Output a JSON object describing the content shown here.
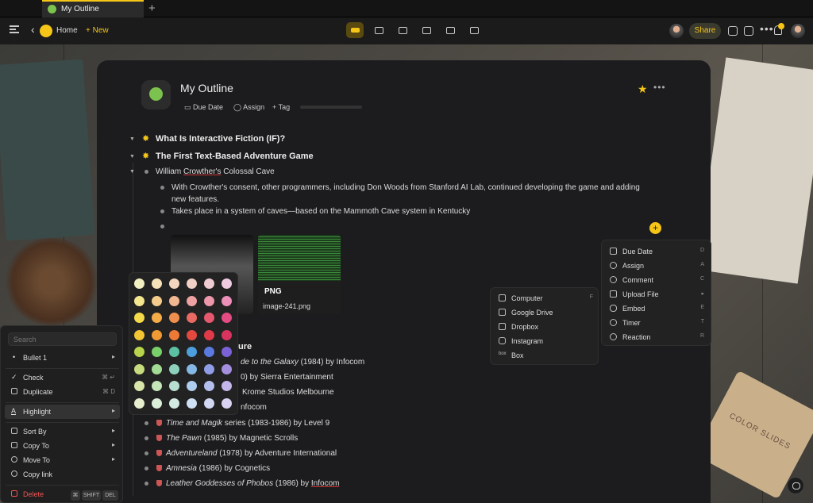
{
  "tab": {
    "title": "My Outline"
  },
  "toolbar": {
    "home": "Home",
    "new": "New",
    "share": "Share"
  },
  "doc": {
    "title": "My Outline",
    "meta": {
      "due_date": "Due Date",
      "assign": "Assign",
      "tag": "Tag"
    }
  },
  "outline": {
    "h1": "What Is Interactive Fiction (IF)?",
    "h2": "The First Text-Based Adventure Game",
    "crowther_a": "William ",
    "crowther_b": "Crowther's",
    "crowther_c": " Colossal Cave",
    "consent_1": "With Crowther's consent, other programmers, including Don Woods from Stanford AI Lab, continued developing the game and adding",
    "consent_2": "new features.",
    "caves": "Takes place in a system of caves—based on the Mammoth Cave system in Kentucky",
    "image": {
      "type": "PNG",
      "name": "image-241.png"
    },
    "partial_heading": "ure",
    "p1a": "de to the Galaxy",
    "p1b": " (1984) by Infocom",
    "p2": "0) by Sierra Entertainment",
    "p3": "Krome Studios Melbourne",
    "p4": "nfocom",
    "g1a": "Time and Magik",
    "g1b": " series (1983-1986) by Level 9",
    "g2a": "The Pawn",
    "g2b": " (1985) by Magnetic Scrolls",
    "g3a": "Adventureland",
    "g3b": " (1978) by Adventure International",
    "g4a": "Amnesia",
    "g4b": " (1986) by Cognetics",
    "g5a": "Leather Goddesses of Phobos",
    "g5b": " (1986) by ",
    "g5c": "Infocom"
  },
  "palette": [
    [
      "#f2efc0",
      "#f6e2b8",
      "#f3d6bd",
      "#f0cfc4",
      "#efcbd3",
      "#eecbe1"
    ],
    [
      "#f3e68e",
      "#f5cb8c",
      "#f2b891",
      "#eda1a1",
      "#ed97ab",
      "#ec8fb9"
    ],
    [
      "#f4d94a",
      "#f4ac49",
      "#ef8f4f",
      "#e96a63",
      "#e5586e",
      "#e24c83"
    ],
    [
      "#f1c533",
      "#f09a33",
      "#ec7a36",
      "#e4493f",
      "#e03a48",
      "#d93460"
    ],
    [
      "#b8d34c",
      "#79d06a",
      "#5cc1a2",
      "#4c9fdc",
      "#5b7ae0",
      "#7a61d6"
    ],
    [
      "#c7db7f",
      "#a4db94",
      "#8dd1bd",
      "#85b8e4",
      "#8e9de6",
      "#a48fdf"
    ],
    [
      "#d9e6a9",
      "#c4e6b9",
      "#b6dfd2",
      "#afcdee",
      "#b5bfee",
      "#c2b6ea"
    ],
    [
      "#e7eecd",
      "#dbeed7",
      "#d3ebe3",
      "#cfdff4",
      "#d2d8f4",
      "#dad2f1"
    ]
  ],
  "context_menu": {
    "search_placeholder": "Search",
    "items": [
      {
        "label": "Bullet 1"
      },
      {
        "label": "Check",
        "shortcut": "⌘ ↵"
      },
      {
        "label": "Duplicate",
        "shortcut": "⌘ D"
      },
      {
        "label": "Highlight"
      },
      {
        "label": "Sort By"
      },
      {
        "label": "Copy To"
      },
      {
        "label": "Move To"
      },
      {
        "label": "Copy link"
      },
      {
        "label": "Delete"
      }
    ],
    "delete_keys": [
      "⌘",
      "SHIFT",
      "DEL"
    ]
  },
  "insert_menu": {
    "items": [
      {
        "label": "Due Date",
        "shortcut": "D"
      },
      {
        "label": "Assign",
        "shortcut": "A"
      },
      {
        "label": "Comment",
        "shortcut": "C"
      },
      {
        "label": "Upload File",
        "shortcut": "▸"
      },
      {
        "label": "Embed",
        "shortcut": "E"
      },
      {
        "label": "Timer",
        "shortcut": "T"
      },
      {
        "label": "Reaction",
        "shortcut": "R"
      }
    ]
  },
  "upload_menu": {
    "items": [
      {
        "label": "Computer",
        "shortcut": "F"
      },
      {
        "label": "Google Drive"
      },
      {
        "label": "Dropbox"
      },
      {
        "label": "Instagram"
      },
      {
        "label": "Box"
      }
    ]
  },
  "soap": {
    "label": "COLOR SLIDES"
  }
}
